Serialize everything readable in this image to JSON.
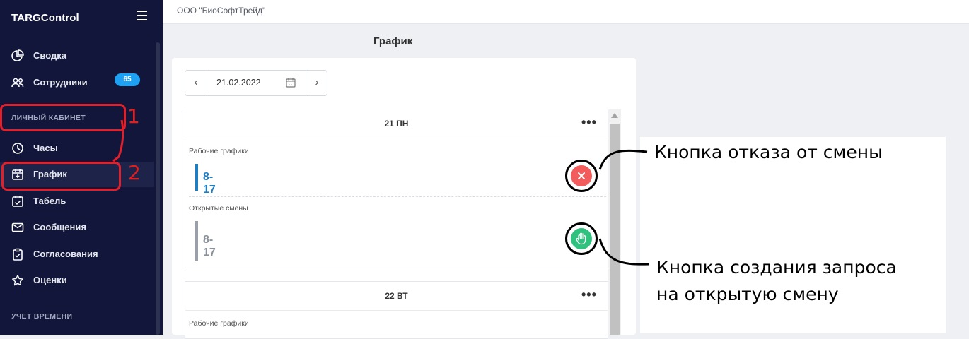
{
  "app": {
    "brand": "TARGControl",
    "company": "ООО \"БиоСофтТрейд\""
  },
  "sidebar": {
    "items": [
      {
        "label": "Сводка",
        "icon": "chart-pie-icon"
      },
      {
        "label": "Сотрудники",
        "icon": "users-icon",
        "badge": "65"
      },
      {
        "label": "Часы",
        "icon": "clock-icon"
      },
      {
        "label": "График",
        "icon": "calendar-plus-icon",
        "active": true
      },
      {
        "label": "Табель",
        "icon": "calendar-check-icon"
      },
      {
        "label": "Сообщения",
        "icon": "mail-icon"
      },
      {
        "label": "Согласования",
        "icon": "clipboard-check-icon"
      },
      {
        "label": "Оценки",
        "icon": "star-icon"
      }
    ],
    "sections": {
      "personal": "ЛИЧНЫЙ КАБИНЕТ",
      "time": "УЧЕТ ВРЕМЕНИ"
    }
  },
  "page": {
    "title": "График"
  },
  "date_picker": {
    "value": "21.02.2022"
  },
  "days": [
    {
      "label": "21 ПН",
      "work_label": "Рабочие графики",
      "work_shift": "8-17",
      "open_label": "Открытые смены",
      "open_shift": "8-17"
    },
    {
      "label": "22 ВТ",
      "work_label": "Рабочие графики"
    }
  ],
  "annotations": {
    "markers": [
      "1",
      "2"
    ],
    "reject": "Кнопка отказа от смены",
    "request_line1": "Кнопка создания запроса",
    "request_line2": "на открытую смену"
  },
  "colors": {
    "sidebar": "#12163a",
    "accent": "#1c7fc6",
    "reject": "#f25c5c",
    "accept": "#2ec27e",
    "annotation": "#e0202a"
  }
}
